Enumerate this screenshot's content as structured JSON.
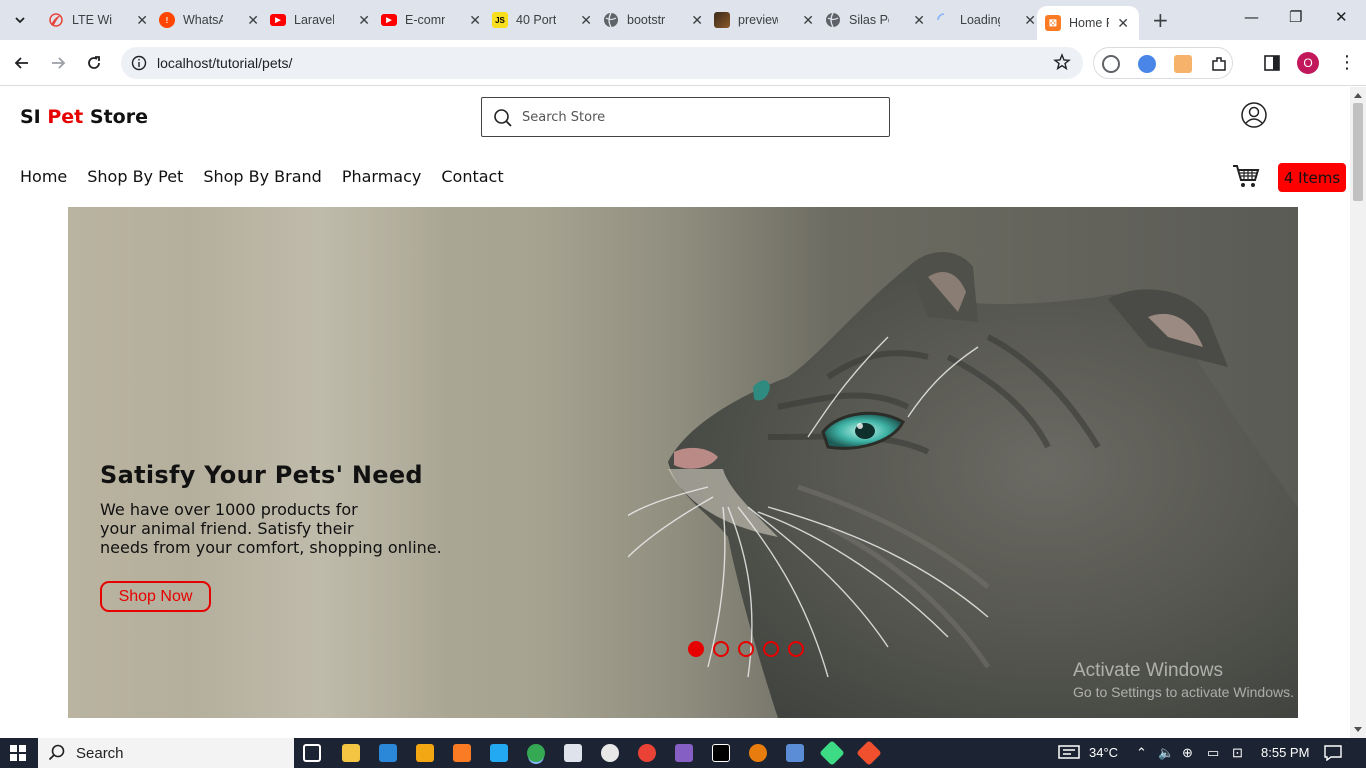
{
  "browser": {
    "tabs": [
      {
        "title": "LTE Wi",
        "color": "#e8453c"
      },
      {
        "title": "WhatsA",
        "color": "#ff4500"
      },
      {
        "title": "Laravel",
        "color": "#ff0000"
      },
      {
        "title": "E-comn",
        "color": "#ff0000"
      },
      {
        "title": "40 Port",
        "color": "#f7df1e",
        "glyph": "JS"
      },
      {
        "title": "bootstr",
        "color": "#5f6368"
      },
      {
        "title": "preview",
        "color": "#6b4a2b"
      },
      {
        "title": "Silas Po",
        "color": "#5f6368"
      },
      {
        "title": "Loading",
        "color": "#ffffff"
      },
      {
        "title": "Home P",
        "color": "#fb7a24"
      }
    ],
    "address": "localhost/tutorial/pets/",
    "profile_initial": "O"
  },
  "site": {
    "brand_prefix": "SI ",
    "brand_accent": "Pet",
    "brand_suffix": " Store",
    "search_placeholder": "Search Store",
    "nav": [
      "Home",
      "Shop By Pet",
      "Shop By Brand",
      "Pharmacy",
      "Contact"
    ],
    "cart_label": "4 Items"
  },
  "hero": {
    "title": "Satisfy Your Pets' Need",
    "line1": "We have over 1000 products for",
    "line2": "your animal friend. Satisfy their",
    "line3": "needs from your comfort, shopping online.",
    "button": "Shop Now",
    "slides": 5,
    "active_slide": 1
  },
  "watermark": {
    "line1": "Activate Windows",
    "line2": "Go to Settings to activate Windows."
  },
  "taskbar": {
    "search": "Search",
    "temperature": "34°C",
    "time": "8:55 PM"
  },
  "colors": {
    "accent": "#e60000",
    "cart_badge": "#ff0000"
  }
}
